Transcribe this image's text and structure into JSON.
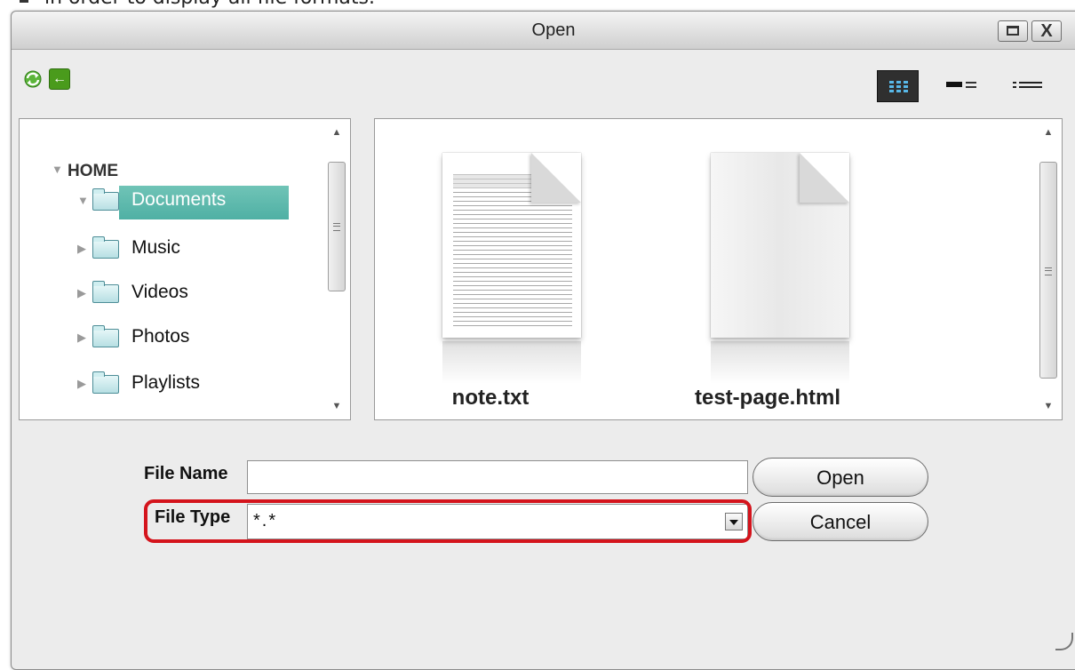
{
  "caption": {
    "text": "in order to display all file formats."
  },
  "window": {
    "title": "Open",
    "buttons": {
      "maximize_icon": "maximize-icon",
      "close_label": "X"
    }
  },
  "toolbar": {
    "refresh_icon": "refresh-icon",
    "back_icon": "back-arrow-icon",
    "back_glyph": "←",
    "views": [
      "icon-grid-view-icon",
      "detail-view-icon",
      "list-view-icon"
    ],
    "active_view": "icon-grid-view-icon"
  },
  "tree": {
    "root": "HOME",
    "items": [
      {
        "label": "Documents",
        "selected": true,
        "expanded": true
      },
      {
        "label": "Music",
        "selected": false
      },
      {
        "label": "Videos",
        "selected": false
      },
      {
        "label": "Photos",
        "selected": false
      },
      {
        "label": "Playlists",
        "selected": false
      }
    ],
    "selection_color": "#5fb9ad"
  },
  "files": [
    {
      "name": "note.txt",
      "icon": "text-document-icon"
    },
    {
      "name": "test-page.html",
      "icon": "blank-document-icon"
    }
  ],
  "form": {
    "file_name_label": "File Name",
    "file_name_value": "",
    "file_type_label": "File Type",
    "file_type_value": "*.*",
    "open_label": "Open",
    "cancel_label": "Cancel",
    "highlight_color": "#d4141c"
  }
}
